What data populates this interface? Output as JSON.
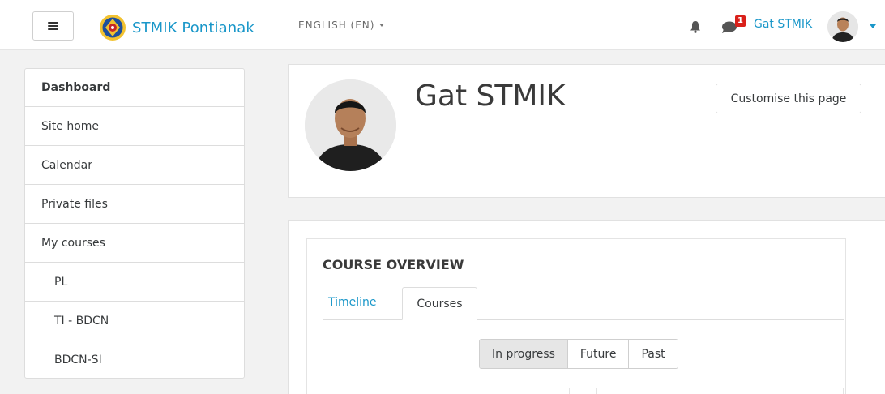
{
  "navbar": {
    "site_name": "STMIK Pontianak",
    "language": "ENGLISH (EN)",
    "notification_count": "1",
    "user_name": "Gat STMIK"
  },
  "sidebar": {
    "items": [
      {
        "label": "Dashboard"
      },
      {
        "label": "Site home"
      },
      {
        "label": "Calendar"
      },
      {
        "label": "Private files"
      },
      {
        "label": "My courses"
      },
      {
        "label": "PL"
      },
      {
        "label": "TI - BDCN"
      },
      {
        "label": "BDCN-SI"
      }
    ]
  },
  "header": {
    "profile_name": "Gat STMIK",
    "customise_label": "Customise this page"
  },
  "course_overview": {
    "title": "COURSE OVERVIEW",
    "tabs": [
      {
        "label": "Timeline"
      },
      {
        "label": "Courses"
      }
    ],
    "filters": [
      {
        "label": "In progress"
      },
      {
        "label": "Future"
      },
      {
        "label": "Past"
      }
    ]
  },
  "colors": {
    "accent": "#1a97c9",
    "badge": "#d9201a",
    "background": "#f2f2f2"
  }
}
